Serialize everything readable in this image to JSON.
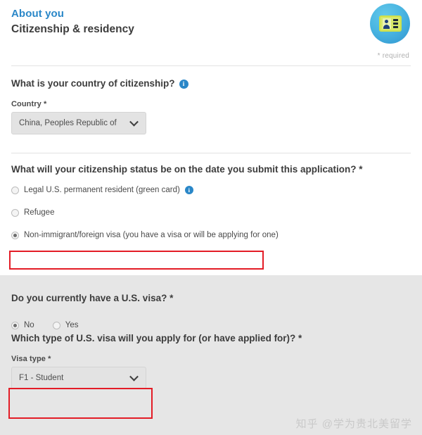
{
  "header": {
    "eyebrow": "About you",
    "title": "Citizenship & residency",
    "badge_icon": "id-card-icon",
    "required_note": "* required"
  },
  "questions": {
    "citizenship_country": {
      "text": "What is your country of citizenship?",
      "info_icon": "info-icon",
      "field_label": "Country *",
      "selected_value": "China, Peoples Republic of",
      "chevron_icon": "chevron-down-icon"
    },
    "citizenship_status": {
      "text": "What will your citizenship status be on the date you submit this application? *",
      "options": [
        {
          "label": "Legal U.S. permanent resident (green card)",
          "checked": false,
          "has_info": true
        },
        {
          "label": "Refugee",
          "checked": false,
          "has_info": false
        },
        {
          "label": "Non-immigrant/foreign visa (you have a visa or will be applying for one)",
          "checked": true,
          "has_info": false
        }
      ]
    },
    "has_us_visa": {
      "text": "Do you currently have a U.S. visa? *",
      "options": [
        {
          "label": "No",
          "checked": true
        },
        {
          "label": "Yes",
          "checked": false
        }
      ]
    },
    "visa_type": {
      "text": "Which type of U.S. visa will you apply for (or have applied for)? *",
      "field_label": "Visa type *",
      "selected_value": "F1 - Student",
      "chevron_icon": "chevron-down-icon"
    }
  },
  "annotations": {
    "highlight_color": "#e31c26",
    "boxes": [
      "non-immigrant-visa-option",
      "visa-type-dropdown"
    ]
  },
  "watermark": {
    "text": "知乎 @学为贵北美留学"
  },
  "colors": {
    "accent_blue": "#2a87c8",
    "text_dark": "#3c3c3c",
    "panel_gray": "#e6e6e6",
    "control_gray": "#e3e3e3"
  }
}
